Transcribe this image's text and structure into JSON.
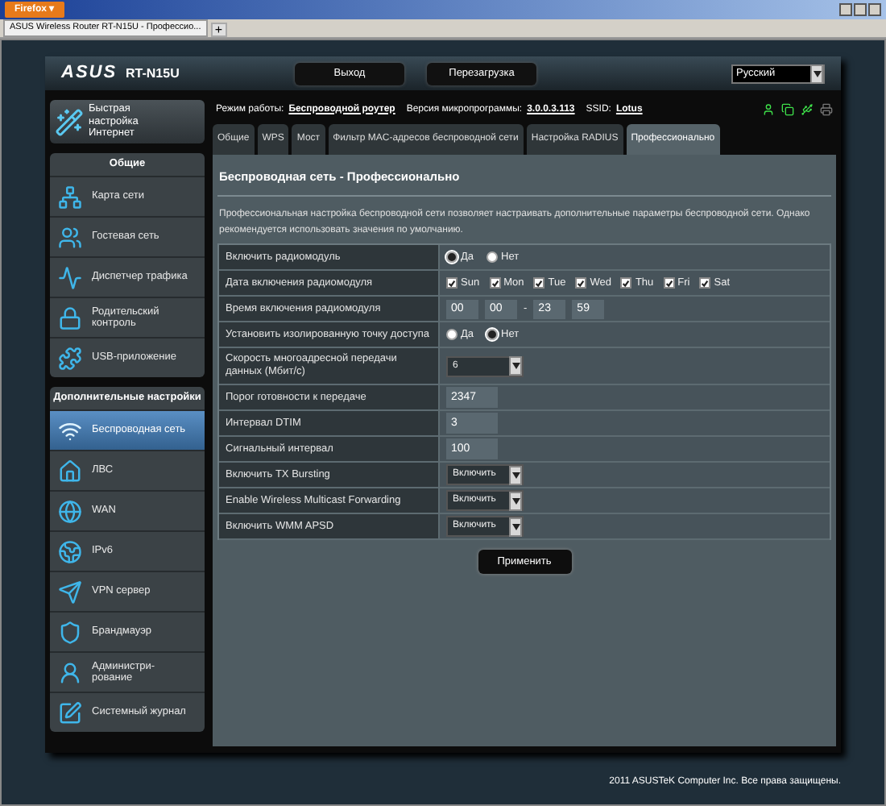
{
  "browser": {
    "menu_button": "Firefox ▾",
    "tab_title": "ASUS Wireless Router RT-N15U - Профессио...",
    "new_tab": "+"
  },
  "header": {
    "logo": "ASUS",
    "model": "RT-N15U",
    "buttons": [
      "Выход",
      "Перезагрузка"
    ],
    "language": "Русский"
  },
  "quick_setup": "Быстрая настройка Интернет",
  "status": {
    "mode_label": "Режим работы:",
    "mode": "Беспроводной роутер",
    "firmware_label": "Версия микропрограммы:",
    "firmware": "3.0.0.3.113",
    "ssid_label": "SSID:",
    "ssid": "Lotus"
  },
  "sidebar": {
    "groups": [
      {
        "title": "Общие",
        "items": [
          {
            "label": "Карта сети",
            "selected": false
          },
          {
            "label": "Гостевая сеть",
            "selected": false
          },
          {
            "label": "Диспетчер трафика",
            "selected": false
          },
          {
            "label": "Родительский контроль",
            "selected": false
          },
          {
            "label": "USB-приложение",
            "selected": false
          }
        ]
      },
      {
        "title": "Дополнительные настройки",
        "items": [
          {
            "label": "Беспроводная сеть",
            "selected": true
          },
          {
            "label": "ЛВС",
            "selected": false
          },
          {
            "label": "WAN",
            "selected": false
          },
          {
            "label": "IPv6",
            "selected": false
          },
          {
            "label": "VPN сервер",
            "selected": false
          },
          {
            "label": "Брандмауэр",
            "selected": false
          },
          {
            "label": "Администри-рование",
            "selected": false
          },
          {
            "label": "Системный журнал",
            "selected": false
          }
        ]
      }
    ]
  },
  "tabs": [
    {
      "label": "Общие",
      "selected": false
    },
    {
      "label": "WPS",
      "selected": false
    },
    {
      "label": "Мост",
      "selected": false
    },
    {
      "label": "Фильтр MAC-адресов беспроводной сети",
      "selected": false
    },
    {
      "label": "Настройка RADIUS",
      "selected": false
    },
    {
      "label": "Профессионально",
      "selected": true
    }
  ],
  "panel": {
    "title": "Беспроводная сеть - Профессионально",
    "description": "Профессиональная настройка беспроводной сети позволяет настраивать дополнительные параметры беспроводной сети. Однако рекомендуется использовать значения по умолчанию.",
    "rows": [
      {
        "kind": "radio",
        "label": "Включить радиомодуль",
        "options": [
          {
            "label": "Да",
            "selected": true
          },
          {
            "label": "Нет",
            "selected": false
          }
        ]
      },
      {
        "kind": "days",
        "label": "Дата включения радиомодуля",
        "options": [
          {
            "label": "Sun",
            "checked": true
          },
          {
            "label": "Mon",
            "checked": true
          },
          {
            "label": "Tue",
            "checked": true
          },
          {
            "label": "Wed",
            "checked": true
          },
          {
            "label": "Thu",
            "checked": true
          },
          {
            "label": "Fri",
            "checked": true
          },
          {
            "label": "Sat",
            "checked": true
          }
        ]
      },
      {
        "kind": "time",
        "label": "Время включения радиомодуля",
        "start": [
          "00",
          "00"
        ],
        "separator": "-",
        "end": [
          "23",
          "59"
        ]
      },
      {
        "kind": "radio",
        "label": "Установить изолированную точку доступа",
        "options": [
          {
            "label": "Да",
            "selected": false
          },
          {
            "label": "Нет",
            "selected": true
          }
        ]
      },
      {
        "kind": "select",
        "label": "Скорость многоадресной передачи данных (Мбит/с)",
        "value": "6"
      },
      {
        "kind": "text",
        "label": "Порог готовности к передаче",
        "value": "2347"
      },
      {
        "kind": "text",
        "label": "Интервал DTIM",
        "value": "3"
      },
      {
        "kind": "text",
        "label": "Сигнальный интервал",
        "value": "100"
      },
      {
        "kind": "select",
        "label": "Включить TX Bursting",
        "value": "Включить"
      },
      {
        "kind": "select",
        "label": "Enable Wireless Multicast Forwarding",
        "value": "Включить"
      },
      {
        "kind": "select",
        "label": "Включить WMM APSD",
        "value": "Включить"
      }
    ],
    "apply": "Применить"
  },
  "footer": "2011 ASUSTeK Computer Inc. Все права защищены."
}
